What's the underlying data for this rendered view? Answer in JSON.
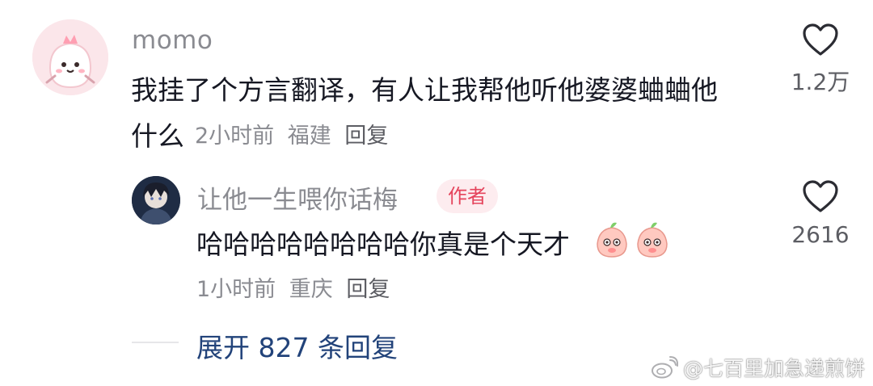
{
  "comments": [
    {
      "username": "momo",
      "text_line1": "我挂了个方言翻译，有人让我帮他听他婆婆蛐蛐他",
      "text_line2": "什么",
      "time": "2小时前",
      "location": "福建",
      "reply_label": "回复",
      "like_count": "1.2万",
      "avatar_icon": "pink-monster-avatar",
      "like_icon": "heart-outline-icon"
    },
    {
      "username": "让他一生喂你话梅",
      "badge": "作者",
      "text": "哈哈哈哈哈哈哈哈你真是个天才",
      "emoji": "peach-face-emoji",
      "time": "1小时前",
      "location": "重庆",
      "reply_label": "回复",
      "like_count": "2616",
      "avatar_icon": "anime-character-avatar",
      "like_icon": "heart-outline-icon"
    }
  ],
  "expand_replies": "展开 827 条回复",
  "watermark": {
    "text": "@七百里加急递煎饼",
    "icon": "weibo-logo-icon"
  },
  "colors": {
    "username": "#8a8b91",
    "text": "#161823",
    "meta": "#8a8b91",
    "badge_bg": "#fdecef",
    "badge_text": "#e5445c",
    "expand_link": "#22437a"
  }
}
